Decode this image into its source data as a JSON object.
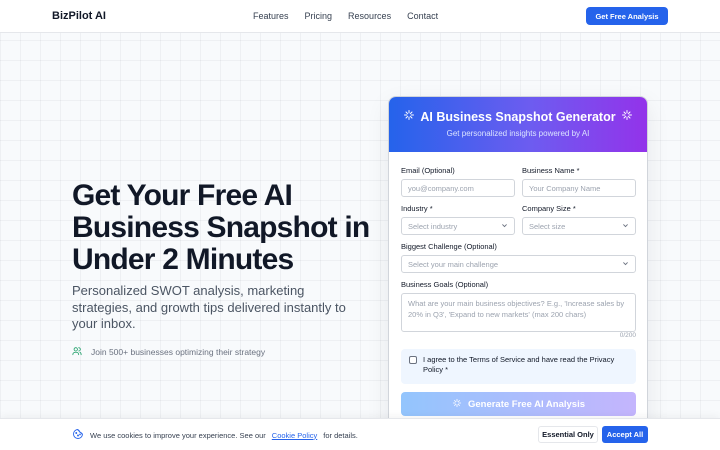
{
  "brand": {
    "name": "BizPilot AI",
    "accent": "#2563eb",
    "gradient_start": "#2563eb",
    "gradient_end": "#9333ea"
  },
  "nav": {
    "items": [
      "Features",
      "Pricing",
      "Resources",
      "Contact"
    ],
    "cta_label": "Get Free Analysis"
  },
  "hero": {
    "title": "Get Your Free AI Business Snapshot in Under 2 Minutes",
    "subtitle": "Personalized SWOT analysis, marketing strategies, and growth tips delivered instantly to your inbox.",
    "social_proof": "Join 500+ businesses optimizing their strategy",
    "social_icon": "users-icon"
  },
  "form": {
    "title": "AI Business Snapshot Generator",
    "subtitle": "Get personalized insights powered by AI",
    "email": {
      "label": "Email (Optional)",
      "placeholder": "you@company.com"
    },
    "business_name": {
      "label": "Business Name *",
      "placeholder": "Your Company Name"
    },
    "industry": {
      "label": "Industry *",
      "value": "Select industry"
    },
    "company_size": {
      "label": "Company Size *",
      "value": "Select size"
    },
    "challenge": {
      "label": "Biggest Challenge (Optional)",
      "value": "Select your main challenge"
    },
    "goals": {
      "label": "Business Goals (Optional)",
      "placeholder": "What are your main business objectives? E.g., 'Increase sales by 20% in Q3', 'Expand to new markets' (max 200 chars)",
      "counter": "0/200"
    },
    "agree_text": "I agree to the Terms of Service and have read the Privacy Policy *",
    "submit_label": "Generate Free AI Analysis"
  },
  "cookie": {
    "text_before": "We use cookies to improve your experience. See our",
    "link_text": "Cookie Policy",
    "text_after": "for details.",
    "essential_label": "Essential Only",
    "accept_label": "Accept All",
    "icon": "cookie-icon"
  }
}
